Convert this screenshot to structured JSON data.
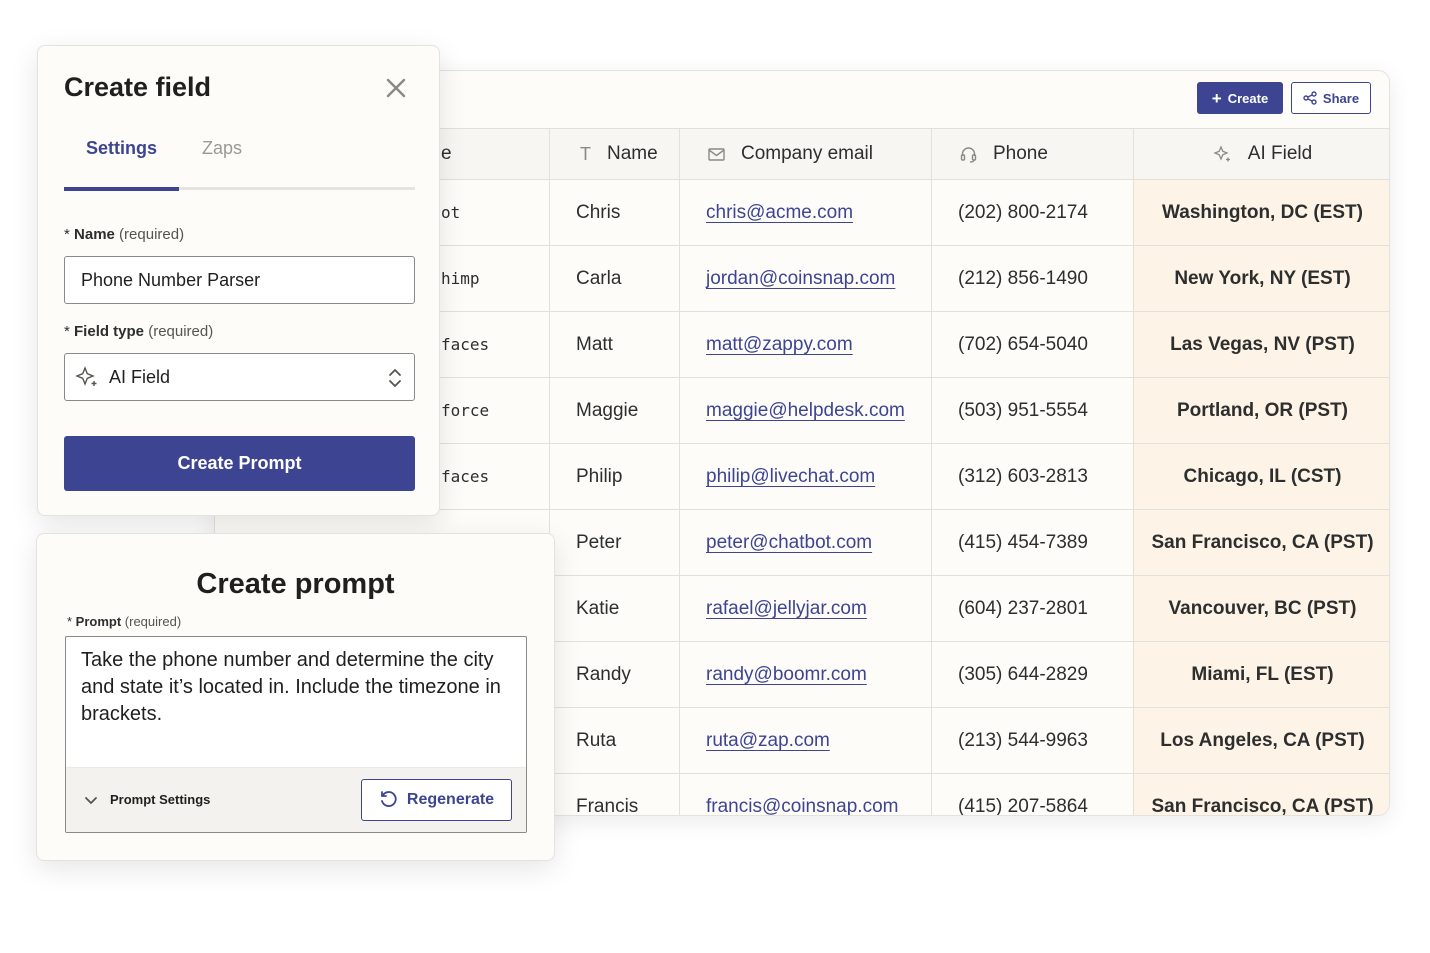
{
  "toolbar": {
    "create_label": "Create",
    "share_label": "Share"
  },
  "table": {
    "partial_header": "e",
    "columns": [
      {
        "label": "Name",
        "icon": "text-type-icon"
      },
      {
        "label": "Company email",
        "icon": "mail-icon"
      },
      {
        "label": "Phone",
        "icon": "headset-icon"
      },
      {
        "label": "AI Field",
        "icon": "sparkle-icon"
      }
    ],
    "rows": [
      {
        "app": "ot",
        "name": "Chris",
        "email": "chris@acme.com",
        "phone": "(202) 800-2174",
        "ai": "Washington, DC (EST)"
      },
      {
        "app": "himp",
        "name": "Carla",
        "email": "jordan@coinsnap.com",
        "phone": "(212) 856-1490",
        "ai": "New York, NY (EST)"
      },
      {
        "app": "faces",
        "name": "Matt",
        "email": "matt@zappy.com",
        "phone": "(702) 654-5040",
        "ai": "Las Vegas, NV (PST)"
      },
      {
        "app": "force",
        "name": "Maggie",
        "email": "maggie@helpdesk.com",
        "phone": "(503) 951-5554",
        "ai": "Portland, OR (PST)"
      },
      {
        "app": "faces",
        "name": "Philip",
        "email": "philip@livechat.com",
        "phone": "(312) 603-2813",
        "ai": "Chicago, IL (CST)"
      },
      {
        "app": "",
        "name": "Peter",
        "email": "peter@chatbot.com",
        "phone": "(415) 454-7389",
        "ai": "San Francisco, CA (PST)"
      },
      {
        "app": "",
        "name": "Katie",
        "email": "rafael@jellyjar.com",
        "phone": "(604) 237-2801",
        "ai": "Vancouver, BC (PST)"
      },
      {
        "app": "",
        "name": "Randy",
        "email": "randy@boomr.com",
        "phone": "(305) 644-2829",
        "ai": "Miami, FL (EST)"
      },
      {
        "app": "",
        "name": "Ruta",
        "email": "ruta@zap.com",
        "phone": "(213) 544-9963",
        "ai": "Los Angeles, CA (PST)"
      },
      {
        "app": "",
        "name": "Francis",
        "email": "francis@coinsnap.com",
        "phone": "(415) 207-5864",
        "ai": "San Francisco, CA (PST)"
      }
    ]
  },
  "create_field": {
    "title": "Create field",
    "tabs": [
      "Settings",
      "Zaps"
    ],
    "name_label": "Name",
    "name_required": "(required)",
    "name_value": "Phone Number Parser",
    "type_label": "Field type",
    "type_required": "(required)",
    "type_value": "AI Field",
    "button_label": "Create Prompt"
  },
  "create_prompt": {
    "title": "Create prompt",
    "prompt_label": "Prompt",
    "prompt_required": "(required)",
    "prompt_text": "Take the phone number and determine the city and state it’s located in. Include the timezone in brackets.",
    "settings_label": "Prompt Settings",
    "regenerate_label": "Regenerate"
  },
  "colors": {
    "accent": "#3d4592",
    "ai_cell_bg": "#fdf3e6",
    "panel_bg": "#fdfcf9"
  }
}
